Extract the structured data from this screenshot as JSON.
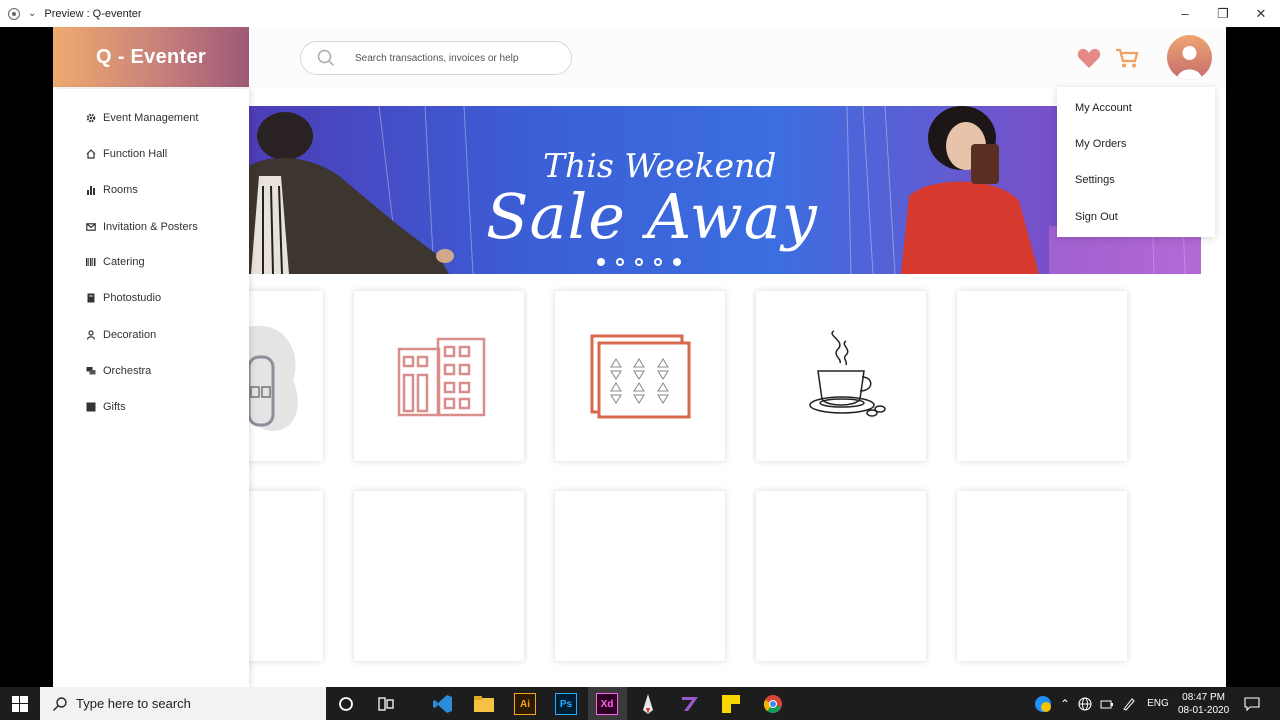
{
  "window": {
    "title": "Preview : Q-eventer"
  },
  "app": {
    "logo_text": "Q - Eventer"
  },
  "search": {
    "placeholder": "Search transactions, invoices or help"
  },
  "sidebar": {
    "items": [
      {
        "label": "Event Management",
        "icon": "gear-icon"
      },
      {
        "label": "Function Hall",
        "icon": "home-icon"
      },
      {
        "label": "Rooms",
        "icon": "bar-chart-icon"
      },
      {
        "label": "Invitation & Posters",
        "icon": "mail-icon"
      },
      {
        "label": "Catering",
        "icon": "barcode-icon"
      },
      {
        "label": "Photostudio",
        "icon": "book-icon"
      },
      {
        "label": "Decoration",
        "icon": "user-icon"
      },
      {
        "label": "Orchestra",
        "icon": "chat-icon"
      },
      {
        "label": "Gifts",
        "icon": "square-icon"
      }
    ]
  },
  "banner": {
    "line1": "This Weekend",
    "line2": "Sale Away",
    "slides": 5
  },
  "account_menu": {
    "items": [
      "My  Account",
      "My Orders",
      "Settings",
      "Sign Out"
    ]
  },
  "taskbar": {
    "search_placeholder": "Type here to search",
    "language": "ENG",
    "time": "08:47 PM",
    "date": "08-01-2020"
  },
  "colors": {
    "accent_start": "#eeab6f",
    "accent_end": "#9c5a77",
    "heart": "#e58a86",
    "cart": "#f0a060"
  }
}
